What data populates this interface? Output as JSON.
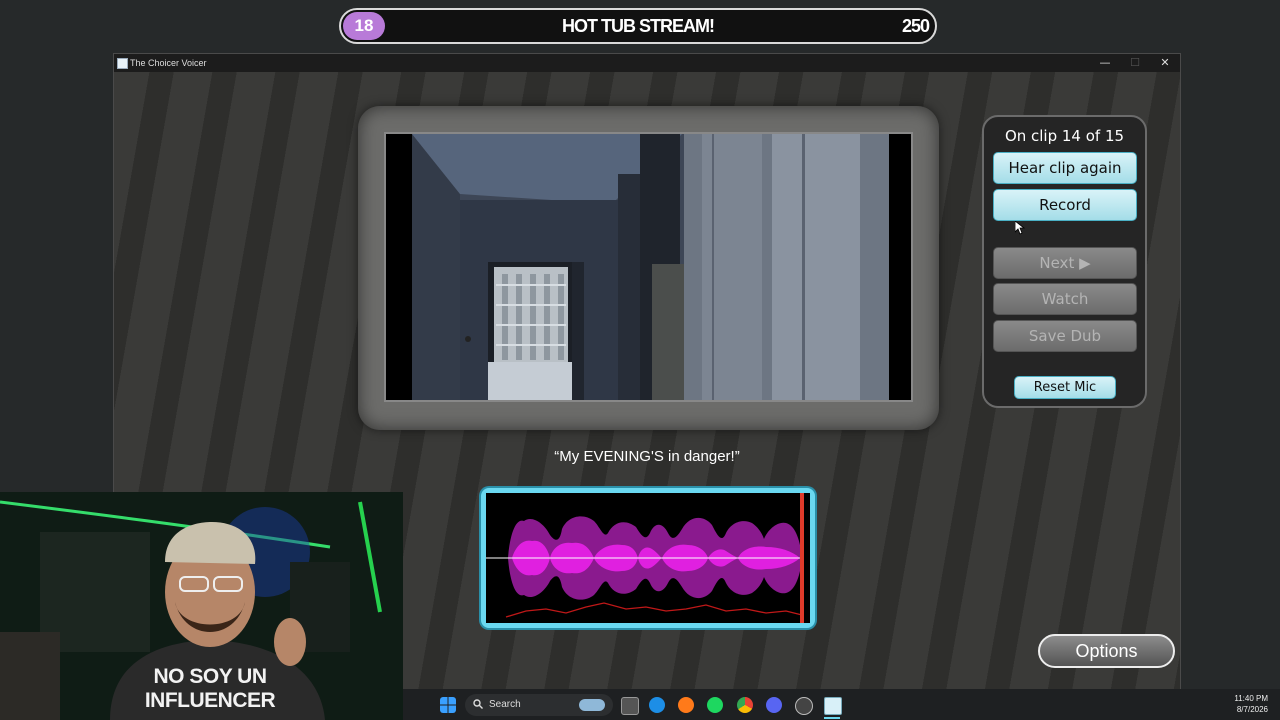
{
  "stream_banner": {
    "left_value": "18",
    "title": "HOT TUB STREAM!",
    "right_value": "250"
  },
  "window": {
    "title": "The Choicer Voicer",
    "controls": {
      "minimize": "—",
      "maximize": "☐",
      "close": "✕"
    }
  },
  "clip": {
    "quote": "“My EVENING'S in danger!”"
  },
  "panel": {
    "progress": "On clip 14 of 15",
    "hear_clip_label": "Hear clip again",
    "record_label": "Record",
    "next_label": "Next ▶",
    "watch_label": "Watch",
    "save_dub_label": "Save Dub",
    "reset_mic_label": "Reset Mic"
  },
  "options_label": "Options",
  "webcam": {
    "shirt_text_line1": "NO SOY UN",
    "shirt_text_line2": "INFLUENCER"
  },
  "taskbar": {
    "search_placeholder": "Search",
    "time": "11:40 PM",
    "date": "8/7/2026"
  },
  "colors": {
    "banner_badge": "#b87ad8",
    "waveform": "#e020e0",
    "waveform_border": "#6ad8f0",
    "button_active": "#a4dde8",
    "playhead": "#e03a2a"
  }
}
